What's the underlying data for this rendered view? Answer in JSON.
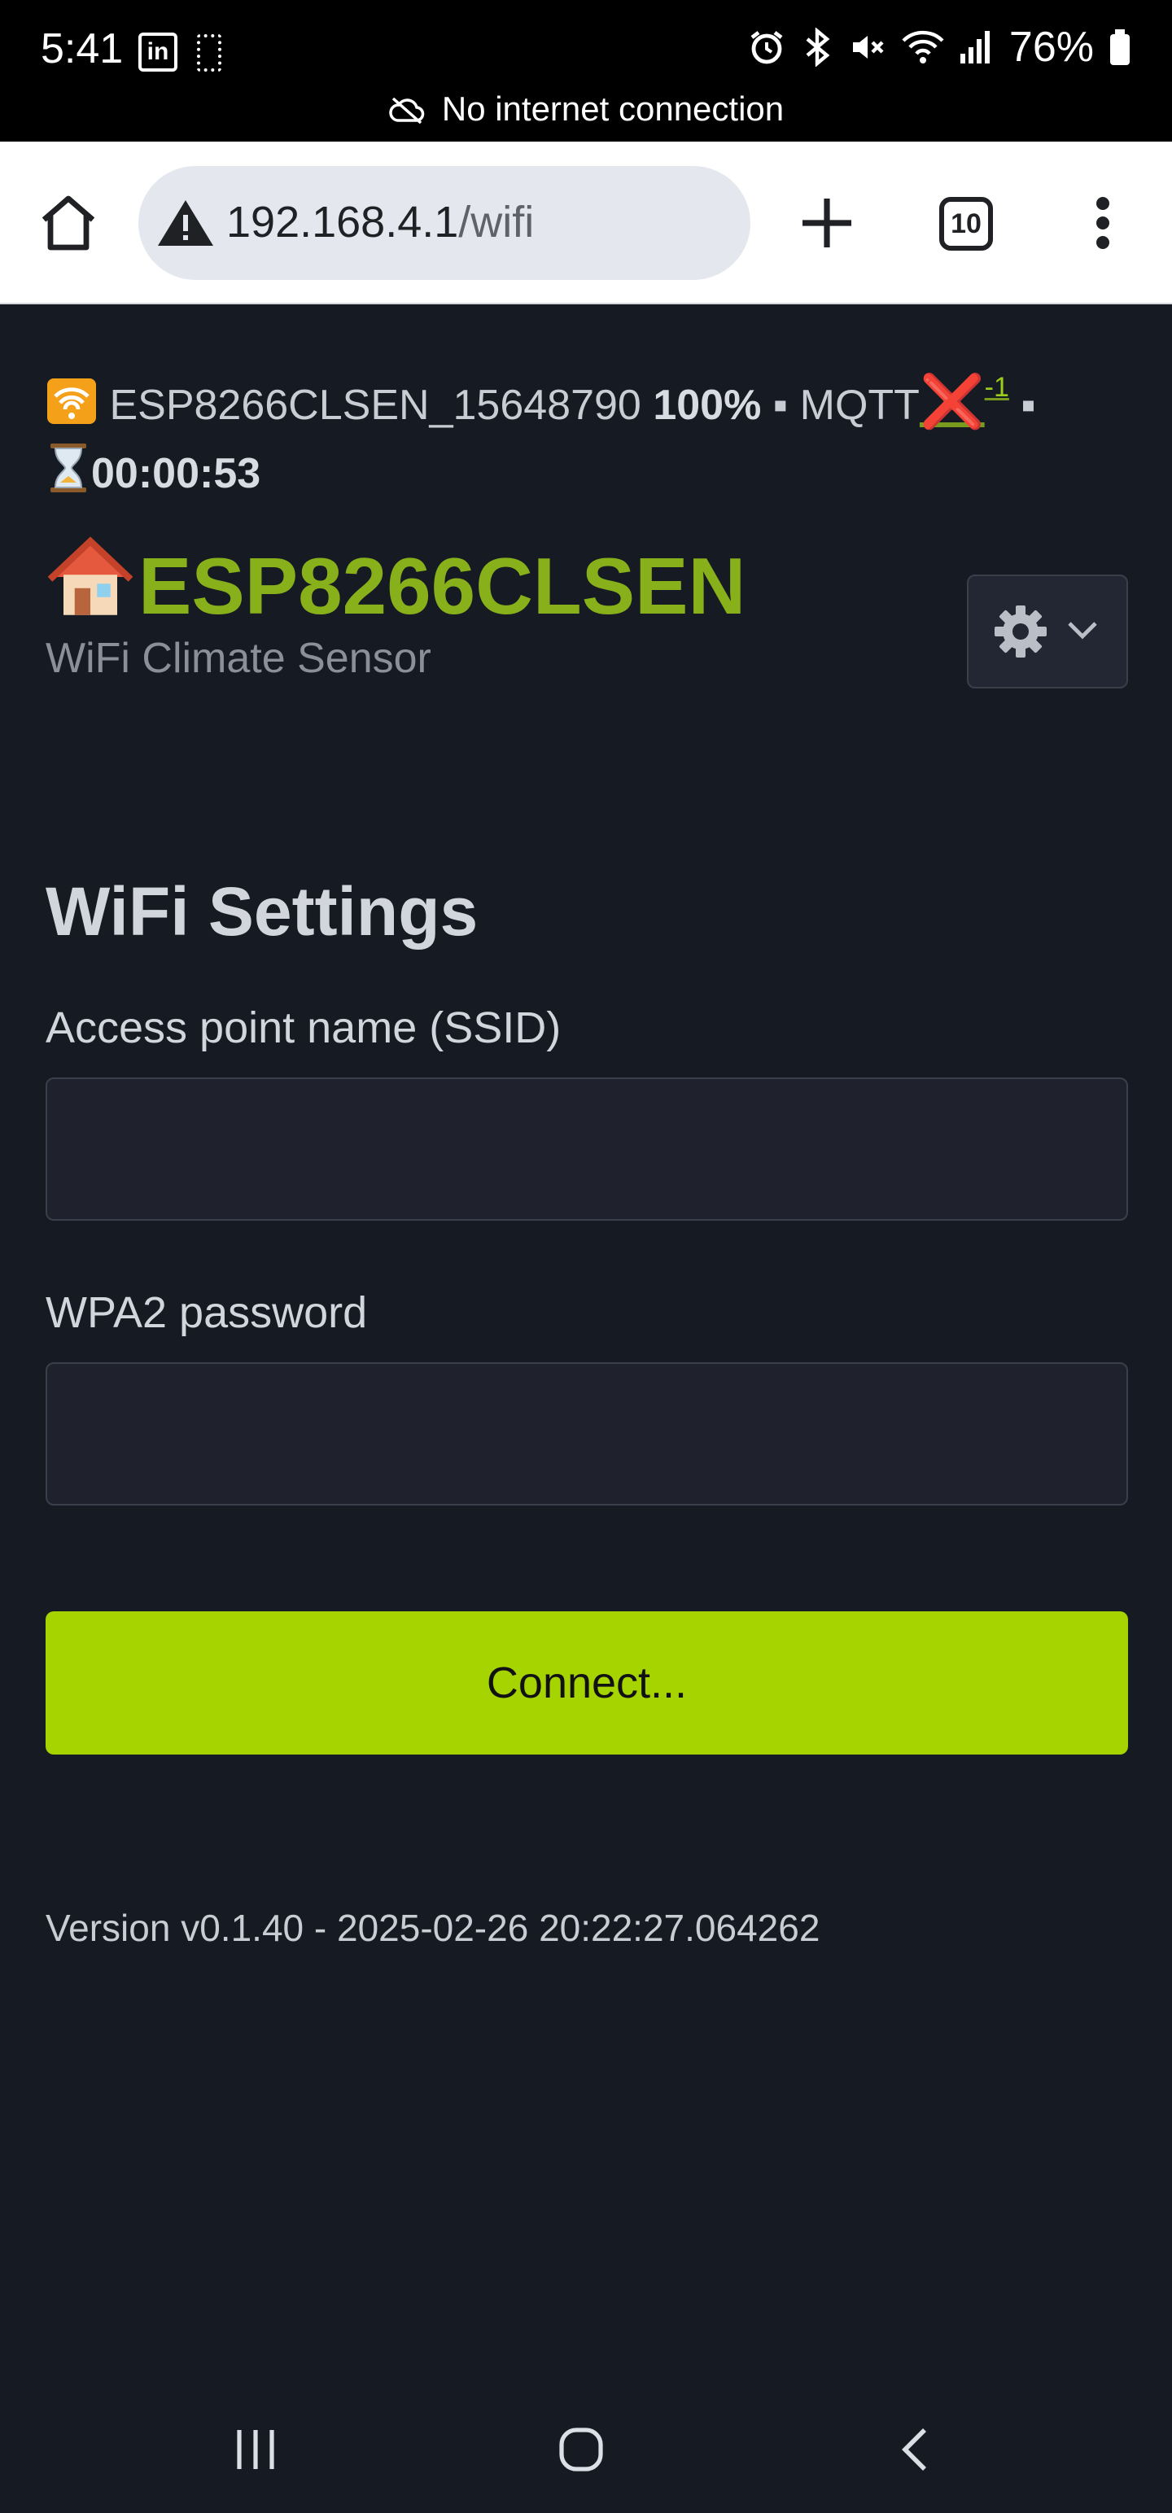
{
  "status_bar": {
    "time": "5:41",
    "battery": "76%",
    "network_message": "No internet connection",
    "icons": [
      "linkedin-icon",
      "screenshot-icon",
      "alarm-icon",
      "bluetooth-icon",
      "mute-icon",
      "wifi-icon",
      "signal-icon",
      "battery-icon"
    ]
  },
  "browser": {
    "url_host": "192.168.4.1",
    "url_path": "/wifi",
    "tab_count": "10",
    "icons": [
      "home-icon",
      "warning-icon",
      "plus-icon",
      "tabs-icon",
      "more-vert-icon"
    ]
  },
  "header": {
    "device_id": "ESP8266CLSEN_15648790",
    "signal": "100%",
    "separator": "▪",
    "mqtt_label": "MQTT",
    "mqtt_status": "❌",
    "mqtt_count": "-1",
    "uptime": "00:00:53",
    "icons": [
      "wifi-signal-emoji",
      "hourglass-emoji"
    ]
  },
  "brand": {
    "title": "ESP8266CLSEN",
    "subtitle": "WiFi Climate Sensor",
    "icon": "house-emoji"
  },
  "settings_menu": {
    "icons": [
      "gear-icon",
      "chevron-down-icon"
    ]
  },
  "form": {
    "title": "WiFi Settings",
    "ssid_label": "Access point name (SSID)",
    "ssid_value": "",
    "password_label": "WPA2 password",
    "password_value": "",
    "connect_label": "Connect..."
  },
  "footer": {
    "version": "Version v0.1.40 - 2025-02-26 20:22:27.064262"
  },
  "colors": {
    "page_bg": "#161a23",
    "brand_green": "#87b01a",
    "button_green": "#a6d400",
    "error_red": "#e0245e"
  }
}
